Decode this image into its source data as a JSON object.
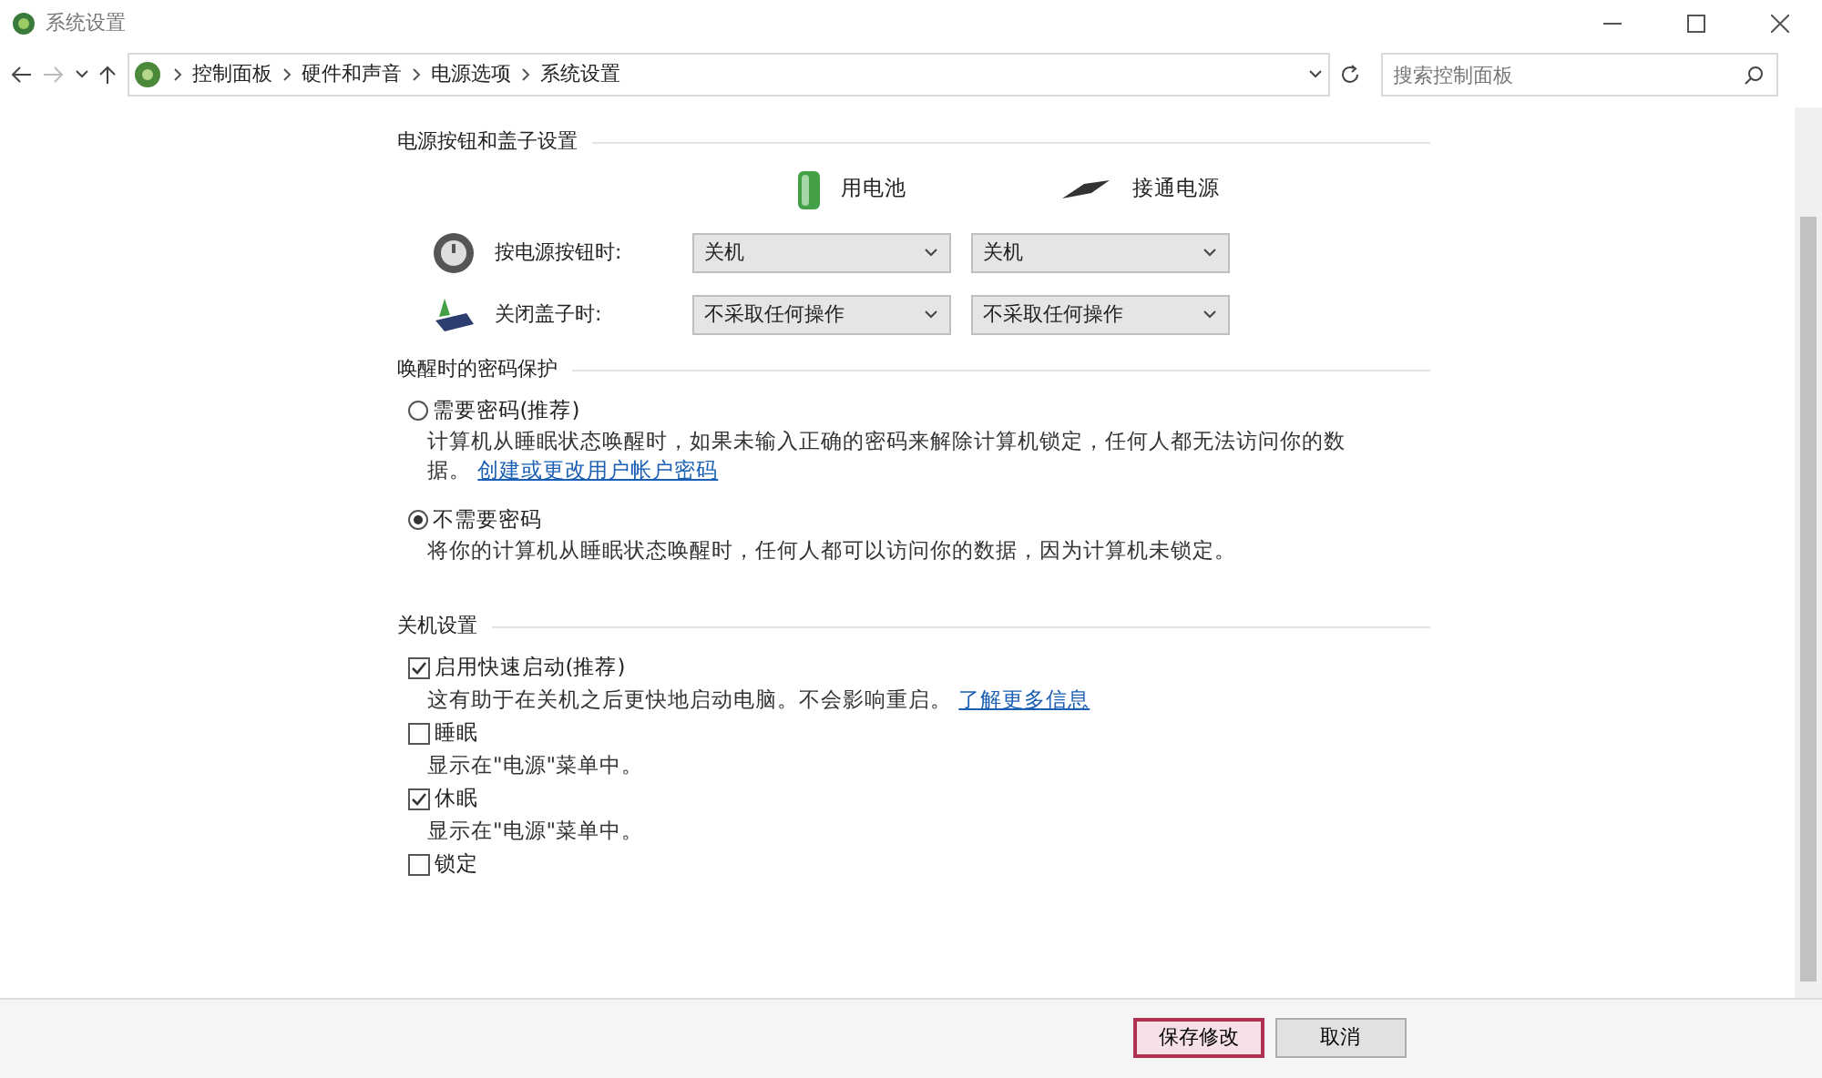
{
  "window": {
    "title": "系统设置"
  },
  "address_bar": {
    "path": [
      "控制面板",
      "硬件和声音",
      "电源选项",
      "系统设置"
    ],
    "search": {
      "placeholder": "搜索控制面板"
    }
  },
  "power_section": {
    "heading": "电源按钮和盖子设置",
    "columns": [
      {
        "label": "用电池",
        "kind": "battery"
      },
      {
        "label": "接通电源",
        "kind": "plug"
      }
    ],
    "rows": [
      {
        "label": "按电源按钮时:",
        "kind": "power",
        "values": [
          "关机",
          "关机"
        ]
      },
      {
        "label": "关闭盖子时:",
        "kind": "lid",
        "values": [
          "不采取任何操作",
          "不采取任何操作"
        ]
      }
    ]
  },
  "password_section": {
    "heading": "唤醒时的密码保护",
    "options": [
      {
        "label": "需要密码(推荐)",
        "selected": false,
        "description": "计算机从睡眠状态唤醒时，如果未输入正确的密码来解除计算机锁定，任何人都无法访问你的数据。",
        "link": "创建或更改用户帐户密码"
      },
      {
        "label": "不需要密码",
        "selected": true,
        "description": "将你的计算机从睡眠状态唤醒时，任何人都可以访问你的数据，因为计算机未锁定。"
      }
    ]
  },
  "shutdown_section": {
    "heading": "关机设置",
    "options": [
      {
        "label": "启用快速启动(推荐)",
        "checked": true,
        "description": "这有助于在关机之后更快地启动电脑。不会影响重启。",
        "link": "了解更多信息"
      },
      {
        "label": "睡眠",
        "checked": false,
        "description": "显示在\"电源\"菜单中。"
      },
      {
        "label": "休眠",
        "checked": true,
        "description": "显示在\"电源\"菜单中。"
      },
      {
        "label": "锁定",
        "checked": false
      }
    ]
  },
  "buttons": [
    {
      "label": "保存修改",
      "primary": true
    },
    {
      "label": "取消",
      "primary": false
    }
  ]
}
